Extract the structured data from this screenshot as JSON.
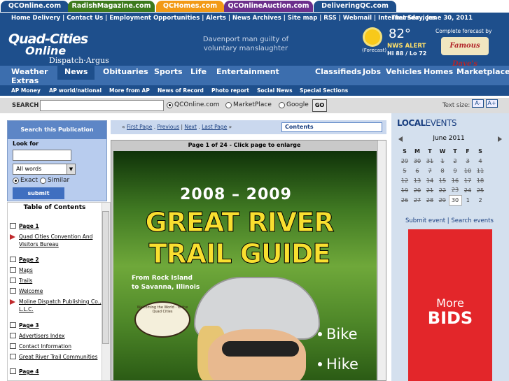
{
  "portal_tabs": [
    {
      "label": "QCOnline.com",
      "color": "#1e4f8c"
    },
    {
      "label": "RadishMagazine.com",
      "color": "#3d7a1d"
    },
    {
      "label": "QCHomes.com",
      "color": "#f29a16"
    },
    {
      "label": "QCOnlineAuction.com",
      "color": "#6c2f8c"
    },
    {
      "label": "DeliveringQC.com",
      "color": "#1e4f8c"
    }
  ],
  "top_links": "Home Delivery | Contact Us | Employment Opportunities | Alerts | News Archives | Site map | RSS | Webmail | Internet Services",
  "date": "Thursday, June 30, 2011",
  "logo": {
    "line1": "Quad-Cities",
    "line2": "Online",
    "line3": "Dispatch·Argus"
  },
  "headline": "Davenport man guilty of voluntary manslaughter",
  "weather": {
    "temp": "82°",
    "forecast_label": "(Forecast)",
    "alert": "NWS ALERT",
    "hilo": "Hi 88 / Lo 72"
  },
  "complete_forecast": "Complete forecast by",
  "sponsor": "Famous Dave's",
  "main_nav": [
    "Weather Extras",
    "News",
    "Obituaries",
    "Sports",
    "Life",
    "Entertainment",
    "Classifieds",
    "Jobs",
    "Vehicles",
    "Homes",
    "Marketplace"
  ],
  "sub_nav": [
    "AP Money",
    "AP world/national",
    "More from AP",
    "News of Record",
    "Photo report",
    "Social News",
    "Special Sections"
  ],
  "search": {
    "label": "SEARCH",
    "options": [
      "QCOnline.com",
      "MarketPlace",
      "Google"
    ],
    "go": "GO",
    "text_size_label": "Text size:",
    "text_size_smaller": "A-",
    "text_size_larger": "A+"
  },
  "publication_search": {
    "title": "Search this Publication",
    "look_for": "Look for",
    "mode": "All words",
    "exact": "Exact",
    "similar": "Similar",
    "submit": "submit"
  },
  "toc": {
    "title": "Table of Contents",
    "items": [
      {
        "type": "page",
        "label": "Page 1"
      },
      {
        "type": "arrow",
        "label": "Quad Cities Convention And Visitors Bureau"
      },
      {
        "type": "page",
        "label": "Page 2"
      },
      {
        "type": "doc",
        "label": "Maps"
      },
      {
        "type": "doc",
        "label": "Trails"
      },
      {
        "type": "doc",
        "label": "Welcome"
      },
      {
        "type": "arrow",
        "label": "Moline Dispatch Publishing Co., L.L.C."
      },
      {
        "type": "page",
        "label": "Page 3"
      },
      {
        "type": "doc",
        "label": "Advertisers Index"
      },
      {
        "type": "doc",
        "label": "Contact Information"
      },
      {
        "type": "doc",
        "label": "Great River Trail Communities"
      },
      {
        "type": "page",
        "label": "Page 4"
      }
    ]
  },
  "page_nav": {
    "links": [
      "First Page",
      "Previous",
      "Next",
      "Last Page"
    ],
    "contents": "Contents",
    "caption": "Page 1 of 24 - Click page to enlarge"
  },
  "cover": {
    "year": "2008 – 2009",
    "title1": "GREAT RIVER",
    "title2": "TRAIL GUIDE",
    "from1": "From Rock Island",
    "from2": "to Savanna, Illinois",
    "badge": "Welcoming the World · to the Quad Cities",
    "activities": [
      "Bike",
      "Hike"
    ]
  },
  "calendar": {
    "brand_a": "LOCAL",
    "brand_b": "EVENTS",
    "month": "June 2011",
    "days": [
      "S",
      "M",
      "T",
      "W",
      "T",
      "F",
      "S"
    ],
    "weeks": [
      [
        "29",
        "30",
        "31",
        "1",
        "2",
        "3",
        "4"
      ],
      [
        "5",
        "6",
        "7",
        "8",
        "9",
        "10",
        "11"
      ],
      [
        "12",
        "13",
        "14",
        "15",
        "16",
        "17",
        "18"
      ],
      [
        "19",
        "20",
        "21",
        "22",
        "23",
        "24",
        "25"
      ],
      [
        "26",
        "27",
        "28",
        "29",
        "30",
        "1",
        "2"
      ]
    ],
    "today": "30",
    "links": "Submit event | Search events"
  },
  "ad": {
    "line1": "More",
    "line2": "BIDS"
  }
}
